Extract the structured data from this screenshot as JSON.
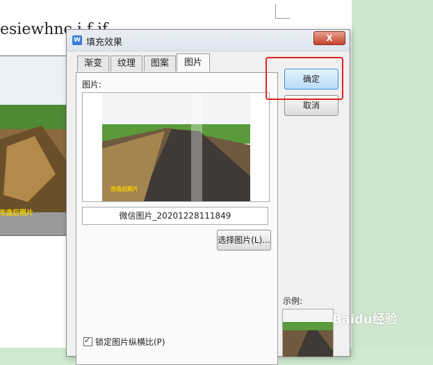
{
  "document": {
    "text": "esiewhnc  i  f    if",
    "photo_caption": "改造后照片"
  },
  "dialog": {
    "title": "填充效果",
    "close_label": "X",
    "tabs": [
      "渐变",
      "纹理",
      "图案",
      "图片"
    ],
    "active_tab": "图片",
    "picture_label": "图片:",
    "preview_caption": "改造后照片",
    "filename": "微信图片_20201228111849",
    "select_button": "选择图片(L)...",
    "lock_aspect": "锁定图片纵横比(P)",
    "lock_aspect_checked": true,
    "ok_button": "确定",
    "cancel_button": "取消",
    "example_label": "示例:"
  },
  "watermark": "Baidu经验",
  "colors": {
    "highlight": "#e02020",
    "ok_border": "#3c8dd6",
    "caption": "#f5d000"
  }
}
